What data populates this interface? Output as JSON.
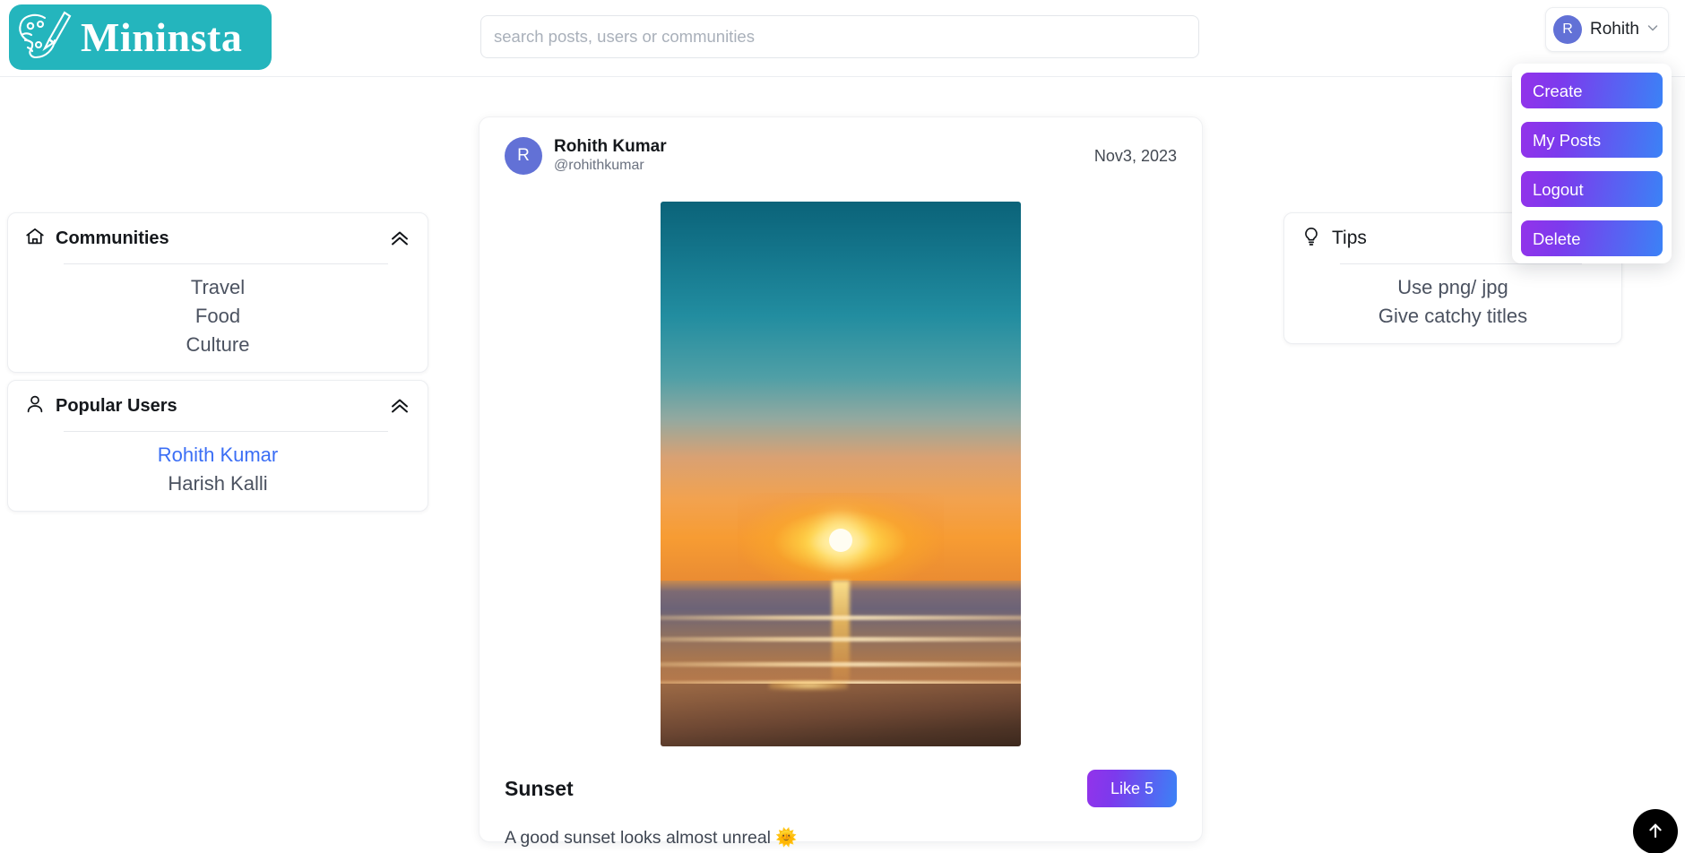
{
  "header": {
    "logo_text": "Mininsta",
    "logo_icon": "paint-palette-icon",
    "logo_bg_color": "#24b5bd",
    "search": {
      "placeholder": "search posts, users or communities",
      "value": ""
    },
    "user_menu": {
      "avatar_initial": "R",
      "name": "Rohith",
      "chevron_icon": "chevron-down-icon",
      "avatar_color": "#6271d6"
    }
  },
  "user_dropdown": {
    "open": true,
    "gradient_from": "#9333ea",
    "gradient_to": "#3b82f6",
    "items": [
      {
        "label": "Create"
      },
      {
        "label": "My Posts"
      },
      {
        "label": "Logout"
      },
      {
        "label": "Delete"
      }
    ]
  },
  "sidebar_left": {
    "communities": {
      "icon": "home-icon",
      "title": "Communities",
      "collapse_icon": "chevrons-up-icon",
      "items": [
        {
          "label": "Travel",
          "is_link": false
        },
        {
          "label": "Food",
          "is_link": false
        },
        {
          "label": "Culture",
          "is_link": false
        }
      ]
    },
    "popular_users": {
      "icon": "person-icon",
      "title": "Popular Users",
      "collapse_icon": "chevrons-up-icon",
      "items": [
        {
          "label": "Rohith Kumar",
          "is_link": true
        },
        {
          "label": "Harish Kalli",
          "is_link": false
        }
      ]
    }
  },
  "sidebar_right": {
    "tips": {
      "icon": "lightbulb-icon",
      "title": "Tips",
      "items": [
        {
          "label": "Use png/ jpg"
        },
        {
          "label": "Give catchy titles"
        }
      ]
    }
  },
  "post": {
    "avatar_initial": "R",
    "author_name": "Rohith Kumar",
    "author_handle": "@rohithkumar",
    "date": "Nov3, 2023",
    "image_alt": "sunset over the sea from a beach",
    "title": "Sunset",
    "like_label": "Like 5",
    "like_count": 5,
    "caption": "A good sunset looks almost unreal  🌞"
  },
  "fab": {
    "icon": "arrow-up-icon",
    "color": "#000000"
  }
}
